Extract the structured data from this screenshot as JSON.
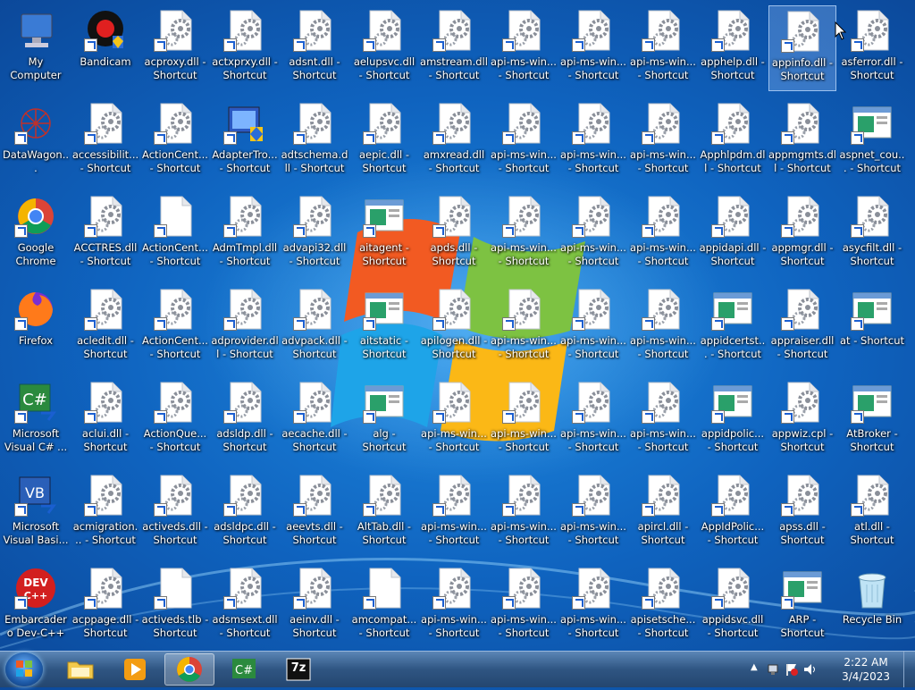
{
  "desktop": {
    "icons": [
      {
        "label": "My Computer",
        "type": "computer"
      },
      {
        "label": "DataWagon...",
        "type": "datawagon"
      },
      {
        "label": "Google Chrome",
        "type": "chrome"
      },
      {
        "label": "Firefox",
        "type": "firefox"
      },
      {
        "label": "Microsoft Visual C# ...",
        "type": "csharp"
      },
      {
        "label": "Microsoft Visual Basi...",
        "type": "vb"
      },
      {
        "label": "Embarcadero Dev-C++",
        "type": "devcpp"
      },
      {
        "label": "Bandicam",
        "type": "bandicam"
      },
      {
        "label": "accessibilit... - Shortcut",
        "type": "dll"
      },
      {
        "label": "ACCTRES.dll - Shortcut",
        "type": "dll"
      },
      {
        "label": "acledit.dll - Shortcut",
        "type": "dll"
      },
      {
        "label": "aclui.dll - Shortcut",
        "type": "dll"
      },
      {
        "label": "acmigration... - Shortcut",
        "type": "dll"
      },
      {
        "label": "acppage.dll - Shortcut",
        "type": "dll"
      },
      {
        "label": "acproxy.dll - Shortcut",
        "type": "dll"
      },
      {
        "label": "ActionCent... - Shortcut",
        "type": "dll"
      },
      {
        "label": "ActionCent... - Shortcut",
        "type": "blank"
      },
      {
        "label": "ActionCent... - Shortcut",
        "type": "dll"
      },
      {
        "label": "ActionQue... - Shortcut",
        "type": "dll"
      },
      {
        "label": "activeds.dll - Shortcut",
        "type": "dll"
      },
      {
        "label": "activeds.tlb - Shortcut",
        "type": "blank"
      },
      {
        "label": "actxprxy.dll - Shortcut",
        "type": "dll"
      },
      {
        "label": "AdapterTro... - Shortcut",
        "type": "adapter"
      },
      {
        "label": "AdmTmpl.dll - Shortcut",
        "type": "dll"
      },
      {
        "label": "adprovider.dll - Shortcut",
        "type": "dll"
      },
      {
        "label": "adsldp.dll - Shortcut",
        "type": "dll"
      },
      {
        "label": "adsldpc.dll - Shortcut",
        "type": "dll"
      },
      {
        "label": "adsmsext.dll - Shortcut",
        "type": "dll"
      },
      {
        "label": "adsnt.dll - Shortcut",
        "type": "dll"
      },
      {
        "label": "adtschema.dll - Shortcut",
        "type": "dll"
      },
      {
        "label": "advapi32.dll - Shortcut",
        "type": "dll"
      },
      {
        "label": "advpack.dll - Shortcut",
        "type": "dll"
      },
      {
        "label": "aecache.dll - Shortcut",
        "type": "dll"
      },
      {
        "label": "aeevts.dll - Shortcut",
        "type": "dll"
      },
      {
        "label": "aeinv.dll - Shortcut",
        "type": "dll"
      },
      {
        "label": "aelupsvc.dll - Shortcut",
        "type": "dll"
      },
      {
        "label": "aepic.dll - Shortcut",
        "type": "dll"
      },
      {
        "label": "aitagent - Shortcut",
        "type": "app"
      },
      {
        "label": "aitstatic - Shortcut",
        "type": "app"
      },
      {
        "label": "alg - Shortcut",
        "type": "app"
      },
      {
        "label": "AltTab.dll - Shortcut",
        "type": "dll"
      },
      {
        "label": "amcompat... - Shortcut",
        "type": "blank"
      },
      {
        "label": "amstream.dll - Shortcut",
        "type": "dll"
      },
      {
        "label": "amxread.dll - Shortcut",
        "type": "dll"
      },
      {
        "label": "apds.dll - Shortcut",
        "type": "dll"
      },
      {
        "label": "apilogen.dll - Shortcut",
        "type": "dll"
      },
      {
        "label": "api-ms-win... - Shortcut",
        "type": "dll"
      },
      {
        "label": "api-ms-win... - Shortcut",
        "type": "dll"
      },
      {
        "label": "api-ms-win... - Shortcut",
        "type": "dll"
      },
      {
        "label": "api-ms-win... - Shortcut",
        "type": "dll"
      },
      {
        "label": "api-ms-win... - Shortcut",
        "type": "dll"
      },
      {
        "label": "api-ms-win... - Shortcut",
        "type": "dll"
      },
      {
        "label": "api-ms-win... - Shortcut",
        "type": "dll"
      },
      {
        "label": "api-ms-win... - Shortcut",
        "type": "dll"
      },
      {
        "label": "api-ms-win... - Shortcut",
        "type": "dll"
      },
      {
        "label": "api-ms-win... - Shortcut",
        "type": "dll"
      },
      {
        "label": "api-ms-win... - Shortcut",
        "type": "dll"
      },
      {
        "label": "api-ms-win... - Shortcut",
        "type": "dll"
      },
      {
        "label": "api-ms-win... - Shortcut",
        "type": "dll"
      },
      {
        "label": "api-ms-win... - Shortcut",
        "type": "dll"
      },
      {
        "label": "api-ms-win... - Shortcut",
        "type": "dll"
      },
      {
        "label": "api-ms-win... - Shortcut",
        "type": "dll"
      },
      {
        "label": "api-ms-win... - Shortcut",
        "type": "dll"
      },
      {
        "label": "api-ms-win... - Shortcut",
        "type": "dll"
      },
      {
        "label": "api-ms-win... - Shortcut",
        "type": "dll"
      },
      {
        "label": "api-ms-win... - Shortcut",
        "type": "dll"
      },
      {
        "label": "api-ms-win... - Shortcut",
        "type": "dll"
      },
      {
        "label": "api-ms-win... - Shortcut",
        "type": "dll"
      },
      {
        "label": "apircl.dll - Shortcut",
        "type": "dll"
      },
      {
        "label": "apisetsche... - Shortcut",
        "type": "dll"
      },
      {
        "label": "apphelp.dll - Shortcut",
        "type": "dll"
      },
      {
        "label": "Apphlpdm.dll - Shortcut",
        "type": "dll"
      },
      {
        "label": "appidapi.dll - Shortcut",
        "type": "dll"
      },
      {
        "label": "appidcertst... - Shortcut",
        "type": "app"
      },
      {
        "label": "appidpolic... - Shortcut",
        "type": "app"
      },
      {
        "label": "AppIdPolic... - Shortcut",
        "type": "dll"
      },
      {
        "label": "appidsvc.dll - Shortcut",
        "type": "dll"
      },
      {
        "label": "appinfo.dll - Shortcut",
        "type": "dll",
        "selected": true
      },
      {
        "label": "appmgmts.dll - Shortcut",
        "type": "dll"
      },
      {
        "label": "appmgr.dll - Shortcut",
        "type": "dll"
      },
      {
        "label": "appraiser.dll - Shortcut",
        "type": "dll"
      },
      {
        "label": "appwiz.cpl - Shortcut",
        "type": "dll"
      },
      {
        "label": "apss.dll - Shortcut",
        "type": "dll"
      },
      {
        "label": "ARP - Shortcut",
        "type": "app"
      },
      {
        "label": "asferror.dll - Shortcut",
        "type": "dll"
      },
      {
        "label": "aspnet_cou... - Shortcut",
        "type": "app"
      },
      {
        "label": "asycfilt.dll - Shortcut",
        "type": "dll"
      },
      {
        "label": "at - Shortcut",
        "type": "app"
      },
      {
        "label": "AtBroker - Shortcut",
        "type": "app"
      },
      {
        "label": "atl.dll - Shortcut",
        "type": "dll"
      },
      {
        "label": "Recycle Bin",
        "type": "recycle"
      }
    ]
  },
  "taskbar": {
    "pinned": [
      {
        "name": "explorer",
        "type": "folder"
      },
      {
        "name": "media-player",
        "type": "media"
      },
      {
        "name": "chrome",
        "type": "chrome",
        "active": true
      },
      {
        "name": "visual-csharp",
        "type": "csharp"
      },
      {
        "name": "7zip",
        "type": "7z",
        "label": "7z"
      }
    ],
    "clock": {
      "time": "2:22 AM",
      "date": "3/4/2023"
    }
  },
  "colors": {
    "accent": "#1c5fd0",
    "taskbar": "#2f5582"
  }
}
